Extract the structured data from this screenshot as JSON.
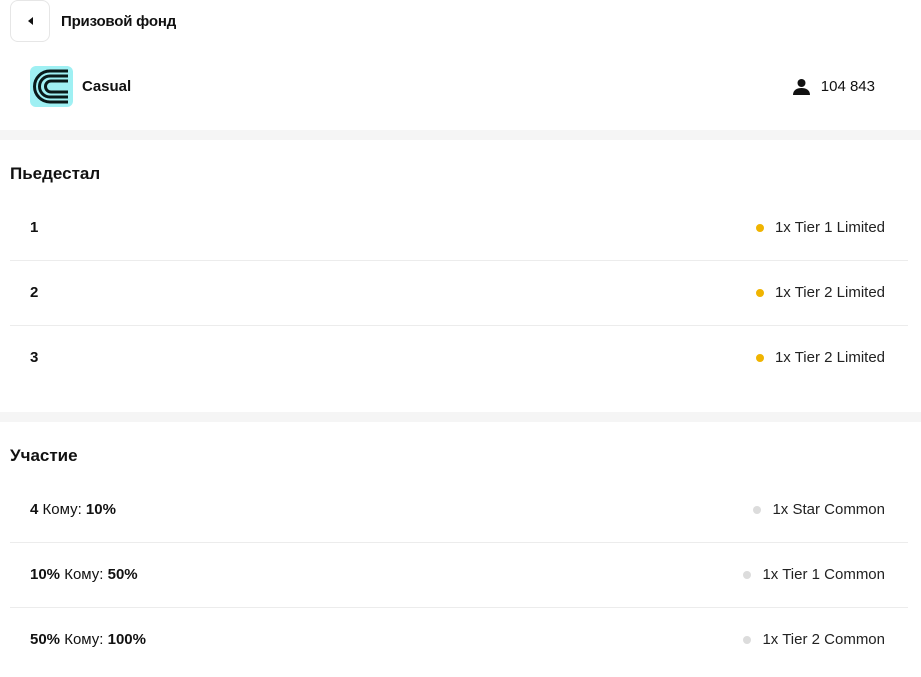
{
  "header": {
    "title": "Призовой фонд",
    "back_icon": "caret-left-icon"
  },
  "competition": {
    "name": "Casual",
    "participants": "104 843",
    "logo_color": "#9ff0f3",
    "participants_icon": "person-icon"
  },
  "podium": {
    "title": "Пьедестал",
    "rows": [
      {
        "rank": "1",
        "reward": "1x Tier 1 Limited"
      },
      {
        "rank": "2",
        "reward": "1x Tier 2 Limited"
      },
      {
        "rank": "3",
        "reward": "1x Tier 2 Limited"
      }
    ],
    "dot_color": "#f0b400"
  },
  "participation": {
    "title": "Участие",
    "rows": [
      {
        "from": "4",
        "to_label": "Кому:",
        "to": "10%",
        "reward": "1x Star Common"
      },
      {
        "from": "10%",
        "to_label": "Кому:",
        "to": "50%",
        "reward": "1x Tier 1 Common"
      },
      {
        "from": "50%",
        "to_label": "Кому:",
        "to": "100%",
        "reward": "1x Tier 2 Common"
      }
    ],
    "dot_color": "#dcdcdc"
  }
}
